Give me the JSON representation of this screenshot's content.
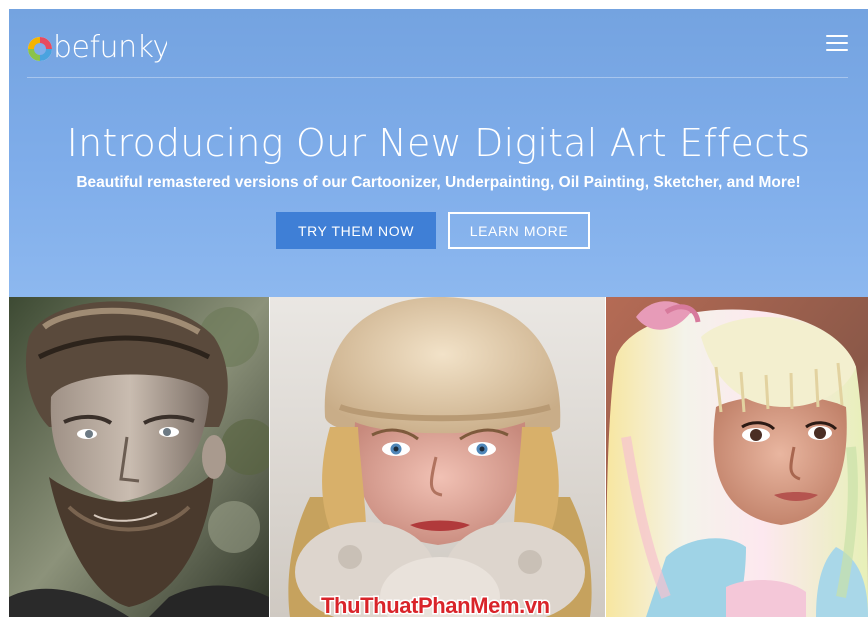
{
  "brand": {
    "logo_text": "befunky"
  },
  "nav": {
    "menu_icon": "hamburger-menu-icon"
  },
  "hero": {
    "headline": "Introducing Our New Digital Art Effects",
    "subline": "Beautiful remastered versions of our Cartoonizer, Underpainting, Oil Painting, Sketcher, and More!",
    "primary_button": "TRY THEM NOW",
    "secondary_button": "LEARN MORE"
  },
  "gallery": {
    "items": [
      {
        "subject": "bearded man portrait",
        "effect": "sketch"
      },
      {
        "subject": "woman in fur hat portrait",
        "effect": "oil painting"
      },
      {
        "subject": "girl with pastel hair portrait",
        "effect": "cartoonizer"
      }
    ]
  },
  "watermark": {
    "text": "ThuThuatPhanMem.vn"
  },
  "colors": {
    "hero_bg": "#7fadea",
    "primary_button": "#3f7fd6",
    "text": "#ffffff",
    "watermark_red": "#d9242a",
    "watermark_blue": "#1f4fa8"
  }
}
